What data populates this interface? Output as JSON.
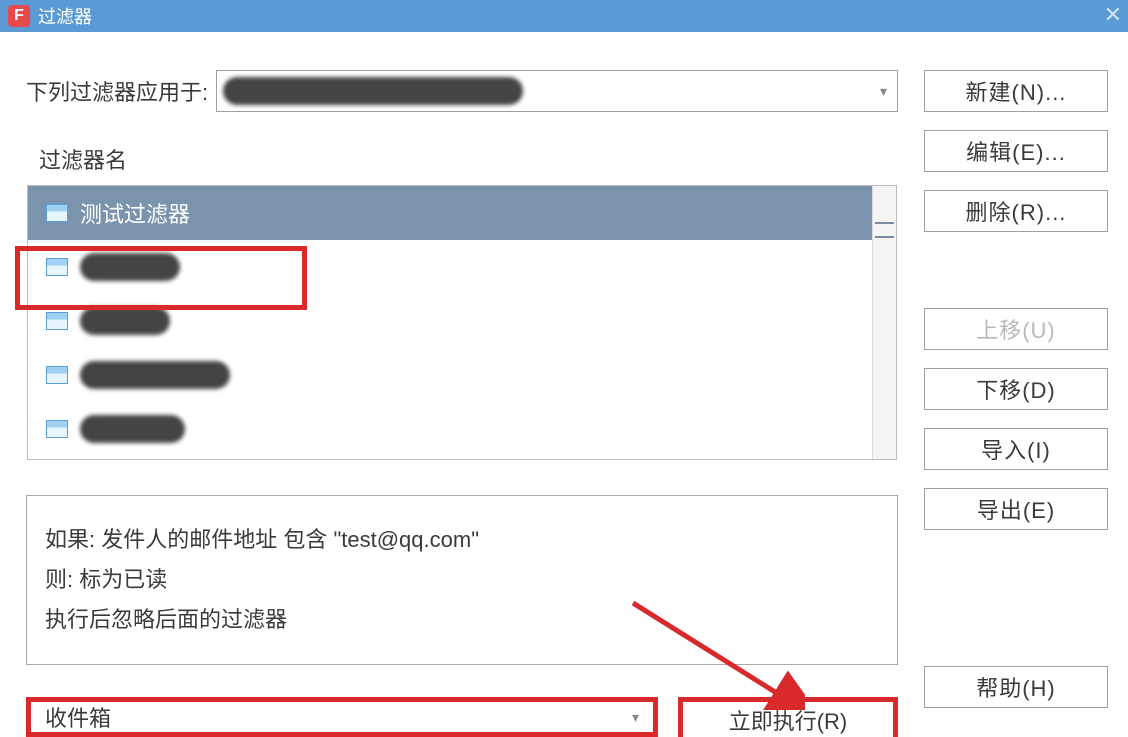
{
  "title_bar": {
    "title": "过滤器"
  },
  "apply_to": {
    "label": "下列过滤器应用于:"
  },
  "filter_list": {
    "header": "过滤器名",
    "items": [
      {
        "name": "测试过滤器",
        "selected": true,
        "obscured": false
      },
      {
        "name": "",
        "selected": false,
        "obscured": true
      },
      {
        "name": "",
        "selected": false,
        "obscured": true
      },
      {
        "name": "",
        "selected": false,
        "obscured": true
      },
      {
        "name": "",
        "selected": false,
        "obscured": true
      }
    ]
  },
  "rule_description": {
    "line1": "如果: 发件人的邮件地址 包含 \"test@qq.com\"",
    "line2": "则:  标为已读",
    "line3": "执行后忽略后面的过滤器"
  },
  "bottom": {
    "folder_label": "收件箱",
    "execute_label": "立即执行(R)"
  },
  "buttons": {
    "new": "新建(N)...",
    "edit": "编辑(E)...",
    "delete": "删除(R)...",
    "move_up": "上移(U)",
    "move_down": "下移(D)",
    "import": "导入(I)",
    "export": "导出(E)",
    "help": "帮助(H)"
  }
}
